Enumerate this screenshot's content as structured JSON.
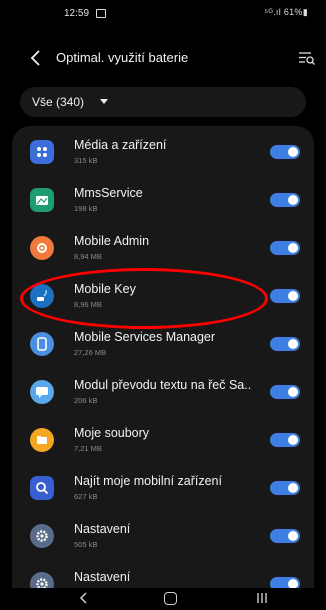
{
  "status_bar": {
    "time": "12:59",
    "signal_battery": "⁵ᴳ.ıl 61%▮"
  },
  "header": {
    "title": "Optimal. využití baterie"
  },
  "filter": {
    "label": "Vše (340)"
  },
  "apps": [
    {
      "name": "Média a zařízení",
      "size": "315 kB",
      "icon": "media-devices-icon",
      "color": "#3d6ddb",
      "enabled": true
    },
    {
      "name": "MmsService",
      "size": "198 kB",
      "icon": "mms-service-icon",
      "color": "#1f9d72",
      "enabled": true
    },
    {
      "name": "Mobile Admin",
      "size": "8,94 MB",
      "icon": "mobile-admin-icon",
      "color": "#f07a3c",
      "enabled": true
    },
    {
      "name": "Mobile Key",
      "size": "8,96 MB",
      "icon": "mobile-key-icon",
      "color": "#1d6fbf",
      "enabled": true
    },
    {
      "name": "Mobile Services Manager",
      "size": "27,26 MB",
      "icon": "mobile-services-manager-icon",
      "color": "#4a8fe0",
      "enabled": true
    },
    {
      "name": "Modul převodu textu na řeč Sa..",
      "size": "206 kB",
      "icon": "text-to-speech-icon",
      "color": "#5aa8ea",
      "enabled": true
    },
    {
      "name": "Moje soubory",
      "size": "7,21 MB",
      "icon": "my-files-icon",
      "color": "#f5a623",
      "enabled": true
    },
    {
      "name": "Najít moje mobilní zařízení",
      "size": "627 kB",
      "icon": "find-my-mobile-icon",
      "color": "#3a5fd0",
      "enabled": true
    },
    {
      "name": "Nastavení",
      "size": "505 kB",
      "icon": "settings-icon",
      "color": "#5b6b8a",
      "enabled": true
    },
    {
      "name": "Nastavení",
      "size": "",
      "icon": "settings-icon",
      "color": "#5b6b8a",
      "enabled": true
    }
  ]
}
